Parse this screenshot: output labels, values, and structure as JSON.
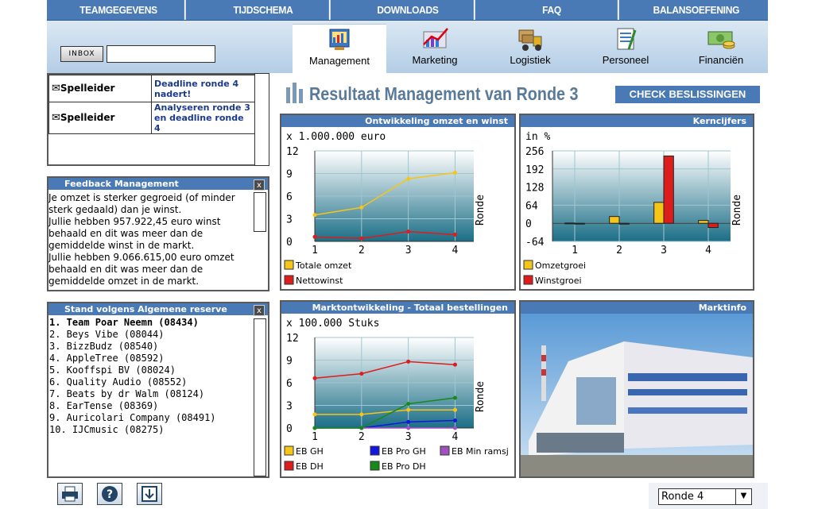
{
  "topnav": [
    "TEAMGEGEVENS",
    "TIJDSCHEMA",
    "DOWNLOADS",
    "FAQ",
    "BALANSOEFENING"
  ],
  "inbox": {
    "button": "INBOX",
    "value": ""
  },
  "tabs": [
    {
      "label": "Management",
      "icon": "management-icon"
    },
    {
      "label": "Marketing",
      "icon": "marketing-icon"
    },
    {
      "label": "Logistiek",
      "icon": "logistics-icon"
    },
    {
      "label": "Personeel",
      "icon": "personnel-icon"
    },
    {
      "label": "Financiën",
      "icon": "finance-icon"
    }
  ],
  "messages": [
    {
      "from": "Spelleider",
      "subject": "Deadline ronde 4 nadert!"
    },
    {
      "from": "Spelleider",
      "subject": "Analyseren ronde 3 en deadline ronde 4"
    }
  ],
  "page_title": "Resultaat Management van Ronde 3",
  "check_button": "CHECK BESLISSINGEN",
  "feedback": {
    "title": "Feedback Management",
    "close": "x",
    "text": "Je omzet is sterker gegroeid (of minder sterk gedaald) dan je winst.\nJullie hebben 957.922,45 euro winst behaald en dit was meer dan de gemiddelde winst in de markt.\nJullie hebben 9.066.615,00 euro omzet behaald en dit was meer dan de gemiddelde omzet in de markt."
  },
  "stand": {
    "title": "Stand volgens Algemene reserve",
    "close": "x",
    "items": [
      "1. Team Poar Neemn (08434)",
      "2. Beys Vibe (08044)",
      "3. BizzBudz (08540)",
      "4. AppleTree (08592)",
      "5. Kooffspi BV (08024)",
      "6. Quality Audio (08552)",
      "7. Beats by dr Walm (08124)",
      "8. EarTense (08369)",
      "9. Auricolari Company (08491)",
      "10. IJCmusic (08275)"
    ]
  },
  "footer": {
    "round_select": "Ronde 4",
    "icons": [
      "print-icon",
      "help-icon",
      "download-icon"
    ]
  },
  "colors": {
    "nav": "#4a7ab5",
    "yellow": "#f5c518",
    "red": "#dd1c1c",
    "blue": "#1018e0",
    "green": "#168a16",
    "purple": "#a050c0"
  },
  "marktinfo": {
    "title": "Marktinfo"
  },
  "chart_data": [
    {
      "type": "line",
      "title": "Ontwikkeling omzet en winst",
      "unit_label": "x 1.000.000 euro",
      "xlabel": "Ronde",
      "x": [
        1,
        2,
        3,
        4
      ],
      "ylim": [
        0,
        12
      ],
      "yticks": [
        0,
        3,
        6,
        9,
        12
      ],
      "series": [
        {
          "name": "Totale omzet",
          "color": "#f5c518",
          "values": [
            3.5,
            4.5,
            8.3,
            9.1
          ]
        },
        {
          "name": "Nettowinst",
          "color": "#dd1c1c",
          "values": [
            0.6,
            0.4,
            1.3,
            0.9
          ]
        }
      ]
    },
    {
      "type": "bar",
      "title": "Kerncijfers",
      "unit_label": "in %",
      "xlabel": "Ronde",
      "categories": [
        1,
        2,
        3,
        4
      ],
      "ylim": [
        -64,
        256
      ],
      "yticks": [
        -64,
        0,
        64,
        128,
        192,
        256
      ],
      "series": [
        {
          "name": "Omzetgroei",
          "color": "#f5c518",
          "values": [
            1,
            24,
            74,
            10
          ]
        },
        {
          "name": "Winstgroei",
          "color": "#dd1c1c",
          "values": [
            0,
            -3,
            238,
            -15
          ]
        }
      ]
    },
    {
      "type": "line",
      "title": "Marktontwikkeling - Totaal bestellingen",
      "unit_label": "x 100.000 Stuks",
      "xlabel": "Ronde",
      "x": [
        1,
        2,
        3,
        4
      ],
      "ylim": [
        0,
        12
      ],
      "yticks": [
        0,
        3,
        6,
        9,
        12
      ],
      "series": [
        {
          "name": "EB GH",
          "color": "#f5c518",
          "values": [
            1.8,
            1.8,
            2.4,
            2.4
          ]
        },
        {
          "name": "EB Pro GH",
          "color": "#1018e0",
          "values": [
            0,
            0,
            0.8,
            1.0
          ]
        },
        {
          "name": "EB Min ramsj",
          "color": "#a050c0",
          "values": [
            0,
            0,
            0,
            0
          ]
        },
        {
          "name": "EB DH",
          "color": "#dd1c1c",
          "values": [
            6.6,
            7.2,
            8.8,
            8.4
          ]
        },
        {
          "name": "EB Pro DH",
          "color": "#168a16",
          "values": [
            0,
            0,
            3.2,
            4.0
          ]
        }
      ]
    }
  ]
}
